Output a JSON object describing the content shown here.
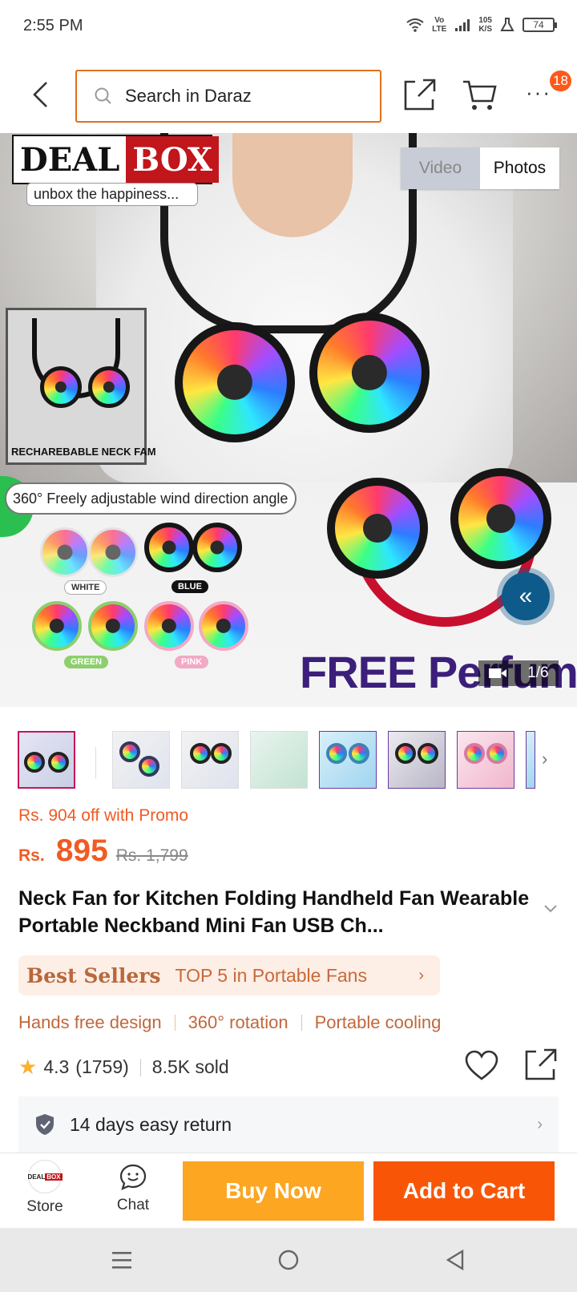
{
  "status_bar": {
    "time": "2:55 PM",
    "network_top": "Vo",
    "network_bottom": "LTE",
    "speed_value": "105",
    "speed_unit": "K/S",
    "battery": "74"
  },
  "header": {
    "search_placeholder": "Search in Daraz",
    "cart_badge": "18",
    "border_color": "#e0701c"
  },
  "hero": {
    "brand_word1": "DEAL",
    "brand_word2": "BOX",
    "brand_tagline": "unbox the happiness...",
    "media_toggle": {
      "video_label": "Video",
      "photos_label": "Photos",
      "selected": "Photos"
    },
    "inset_label": "RECHAREBABLE NECK FAM",
    "wind_text": "360° Freely adjustable wind direction angle",
    "swatches": [
      "WHITE",
      "BLUE",
      "GREEN",
      "PINK"
    ],
    "free_text": "FREE Perfume",
    "counter": "1/6"
  },
  "product": {
    "promo": "Rs. 904 off with Promo",
    "currency": "Rs.",
    "price": "895",
    "old_price": "Rs. 1,799",
    "title": "Neck Fan for Kitchen Folding Handheld Fan Wearable Portable Neckband Mini Fan USB Ch...",
    "best_seller_label": "Best Sellers",
    "best_seller_text": "TOP 5 in Portable Fans",
    "features": [
      "Hands free design",
      "360° rotation",
      "Portable cooling"
    ],
    "rating": "4.3",
    "reviews": "(1759)",
    "sold": "8.5K sold",
    "return_text": "14 days easy return",
    "accent_color": "#f15a22"
  },
  "bottom_bar": {
    "store_label": "Store",
    "chat_label": "Chat",
    "buy_now": "Buy Now",
    "add_to_cart": "Add to Cart",
    "buy_color": "#fca622",
    "cart_color": "#f85606"
  }
}
